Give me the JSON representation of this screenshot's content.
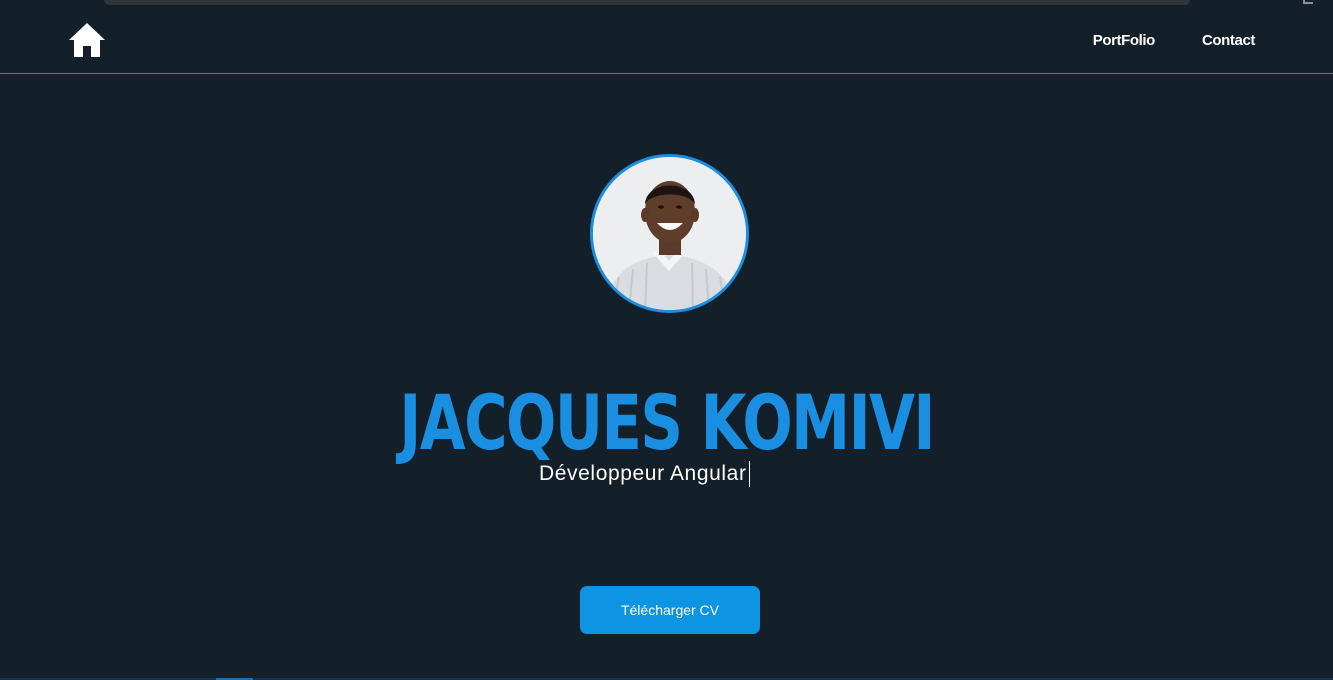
{
  "header": {
    "home_icon": "home-icon",
    "nav": [
      {
        "label": "PortFolio"
      },
      {
        "label": "Contact"
      }
    ]
  },
  "hero": {
    "name": "JACQUES KOMIVI",
    "subtitle": "Développeur Angular",
    "download_label": "Télécharger CV"
  },
  "colors": {
    "background": "#131f29",
    "accent": "#1a8ee0",
    "button": "#0d94e3",
    "text": "#ffffff"
  }
}
